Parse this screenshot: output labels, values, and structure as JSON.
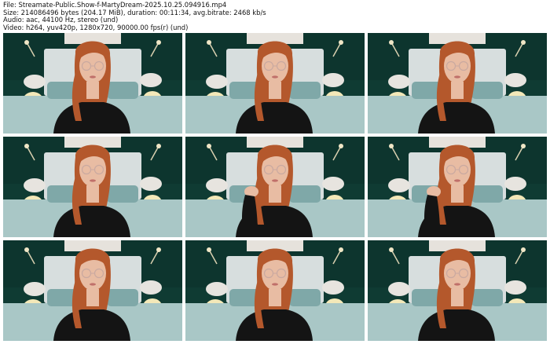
{
  "header": {
    "file": "File: Streamate-Public.Show-f-MartyDream-2025.10.25.094916.mp4",
    "size": "Size: 214086496 bytes (204.17 MiB), duration: 00:11:34, avg.bitrate: 2468 kb/s",
    "audio": "Audio: aac, 44100 Hz, stereo (und)",
    "video": "Video: h264, yuv420p, 1280x720, 90000.00 fps(r) (und)"
  },
  "thumbnails": [
    {
      "id": 1,
      "pose": "center"
    },
    {
      "id": 2,
      "pose": "center"
    },
    {
      "id": 3,
      "pose": "center"
    },
    {
      "id": 4,
      "pose": "center"
    },
    {
      "id": 5,
      "pose": "hand-hair"
    },
    {
      "id": 6,
      "pose": "hand-hair"
    },
    {
      "id": 7,
      "pose": "center"
    },
    {
      "id": 8,
      "pose": "center"
    },
    {
      "id": 9,
      "pose": "center"
    }
  ],
  "colors": {
    "wall": "#0f3b33",
    "headboard": "#d7dede",
    "bed": "#a9c7c6",
    "hair": "#b4582c",
    "skin": "#e8bca3",
    "shirt": "#141414",
    "lamp": "#f3e8b8"
  }
}
